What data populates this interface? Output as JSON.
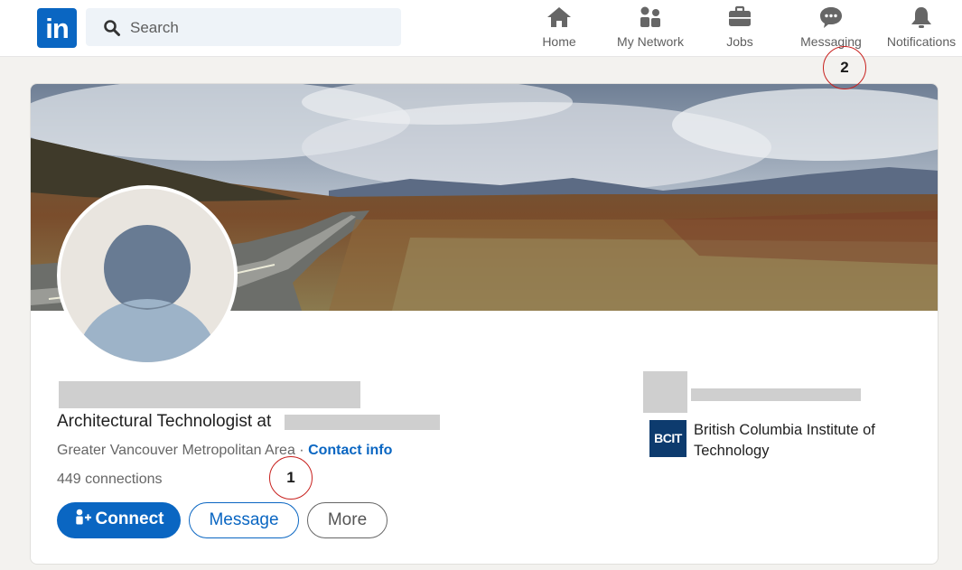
{
  "nav": {
    "logo_text": "in",
    "search_placeholder": "Search",
    "items": [
      {
        "label": "Home",
        "icon": "home-icon"
      },
      {
        "label": "My Network",
        "icon": "network-icon"
      },
      {
        "label": "Jobs",
        "icon": "briefcase-icon"
      },
      {
        "label": "Messaging",
        "icon": "chat-icon"
      },
      {
        "label": "Notifications",
        "icon": "bell-icon"
      }
    ]
  },
  "annotations": {
    "marker_1": "1",
    "marker_2": "2"
  },
  "profile": {
    "headline": "Architectural Technologist at",
    "location": "Greater Vancouver Metropolitan Area",
    "separator": " · ",
    "contact_info": "Contact info",
    "connections": "449 connections",
    "actions": {
      "connect": "Connect",
      "message": "Message",
      "more": "More"
    },
    "education": {
      "logo_text": "BCIT",
      "name": "British Columbia Institute of Technology"
    }
  },
  "colors": {
    "brand": "#0a66c2",
    "annotation": "#c8211e"
  }
}
